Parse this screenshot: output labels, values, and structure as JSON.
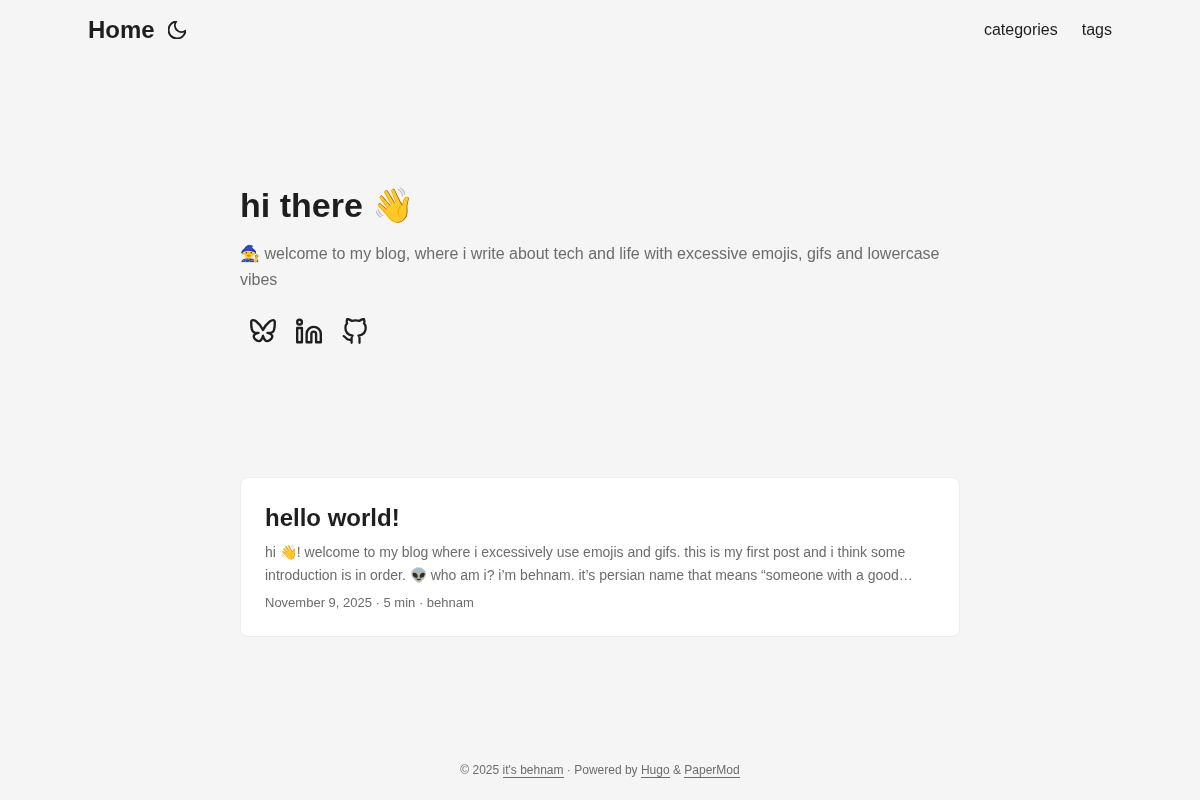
{
  "header": {
    "logo": "Home",
    "menu": [
      {
        "label": "categories"
      },
      {
        "label": "tags"
      }
    ]
  },
  "profile": {
    "title": "hi there 👋",
    "subtitle": "🧙 welcome to my blog, where i write about tech and life with excessive emojis, gifs and lowercase vibes",
    "social_links": [
      {
        "kind": "bluesky"
      },
      {
        "kind": "linkedin"
      },
      {
        "kind": "github"
      }
    ]
  },
  "posts": [
    {
      "title": "hello world!",
      "summary": "hi 👋! welcome to my blog where i excessively use emojis and gifs. this is my first post and i think some introduction is in order. 👽 who am i? i’m behnam. it’s persian name that means “someone with a good…",
      "meta": "November 9, 2025 · 5 min · behnam"
    }
  ],
  "footer": {
    "copyright": "© 2025",
    "owner_link": "it's behnam",
    "separator": "·",
    "powered_by": "Powered by",
    "engine_link": "Hugo",
    "conjunction": "&",
    "theme_link": "PaperMod"
  }
}
